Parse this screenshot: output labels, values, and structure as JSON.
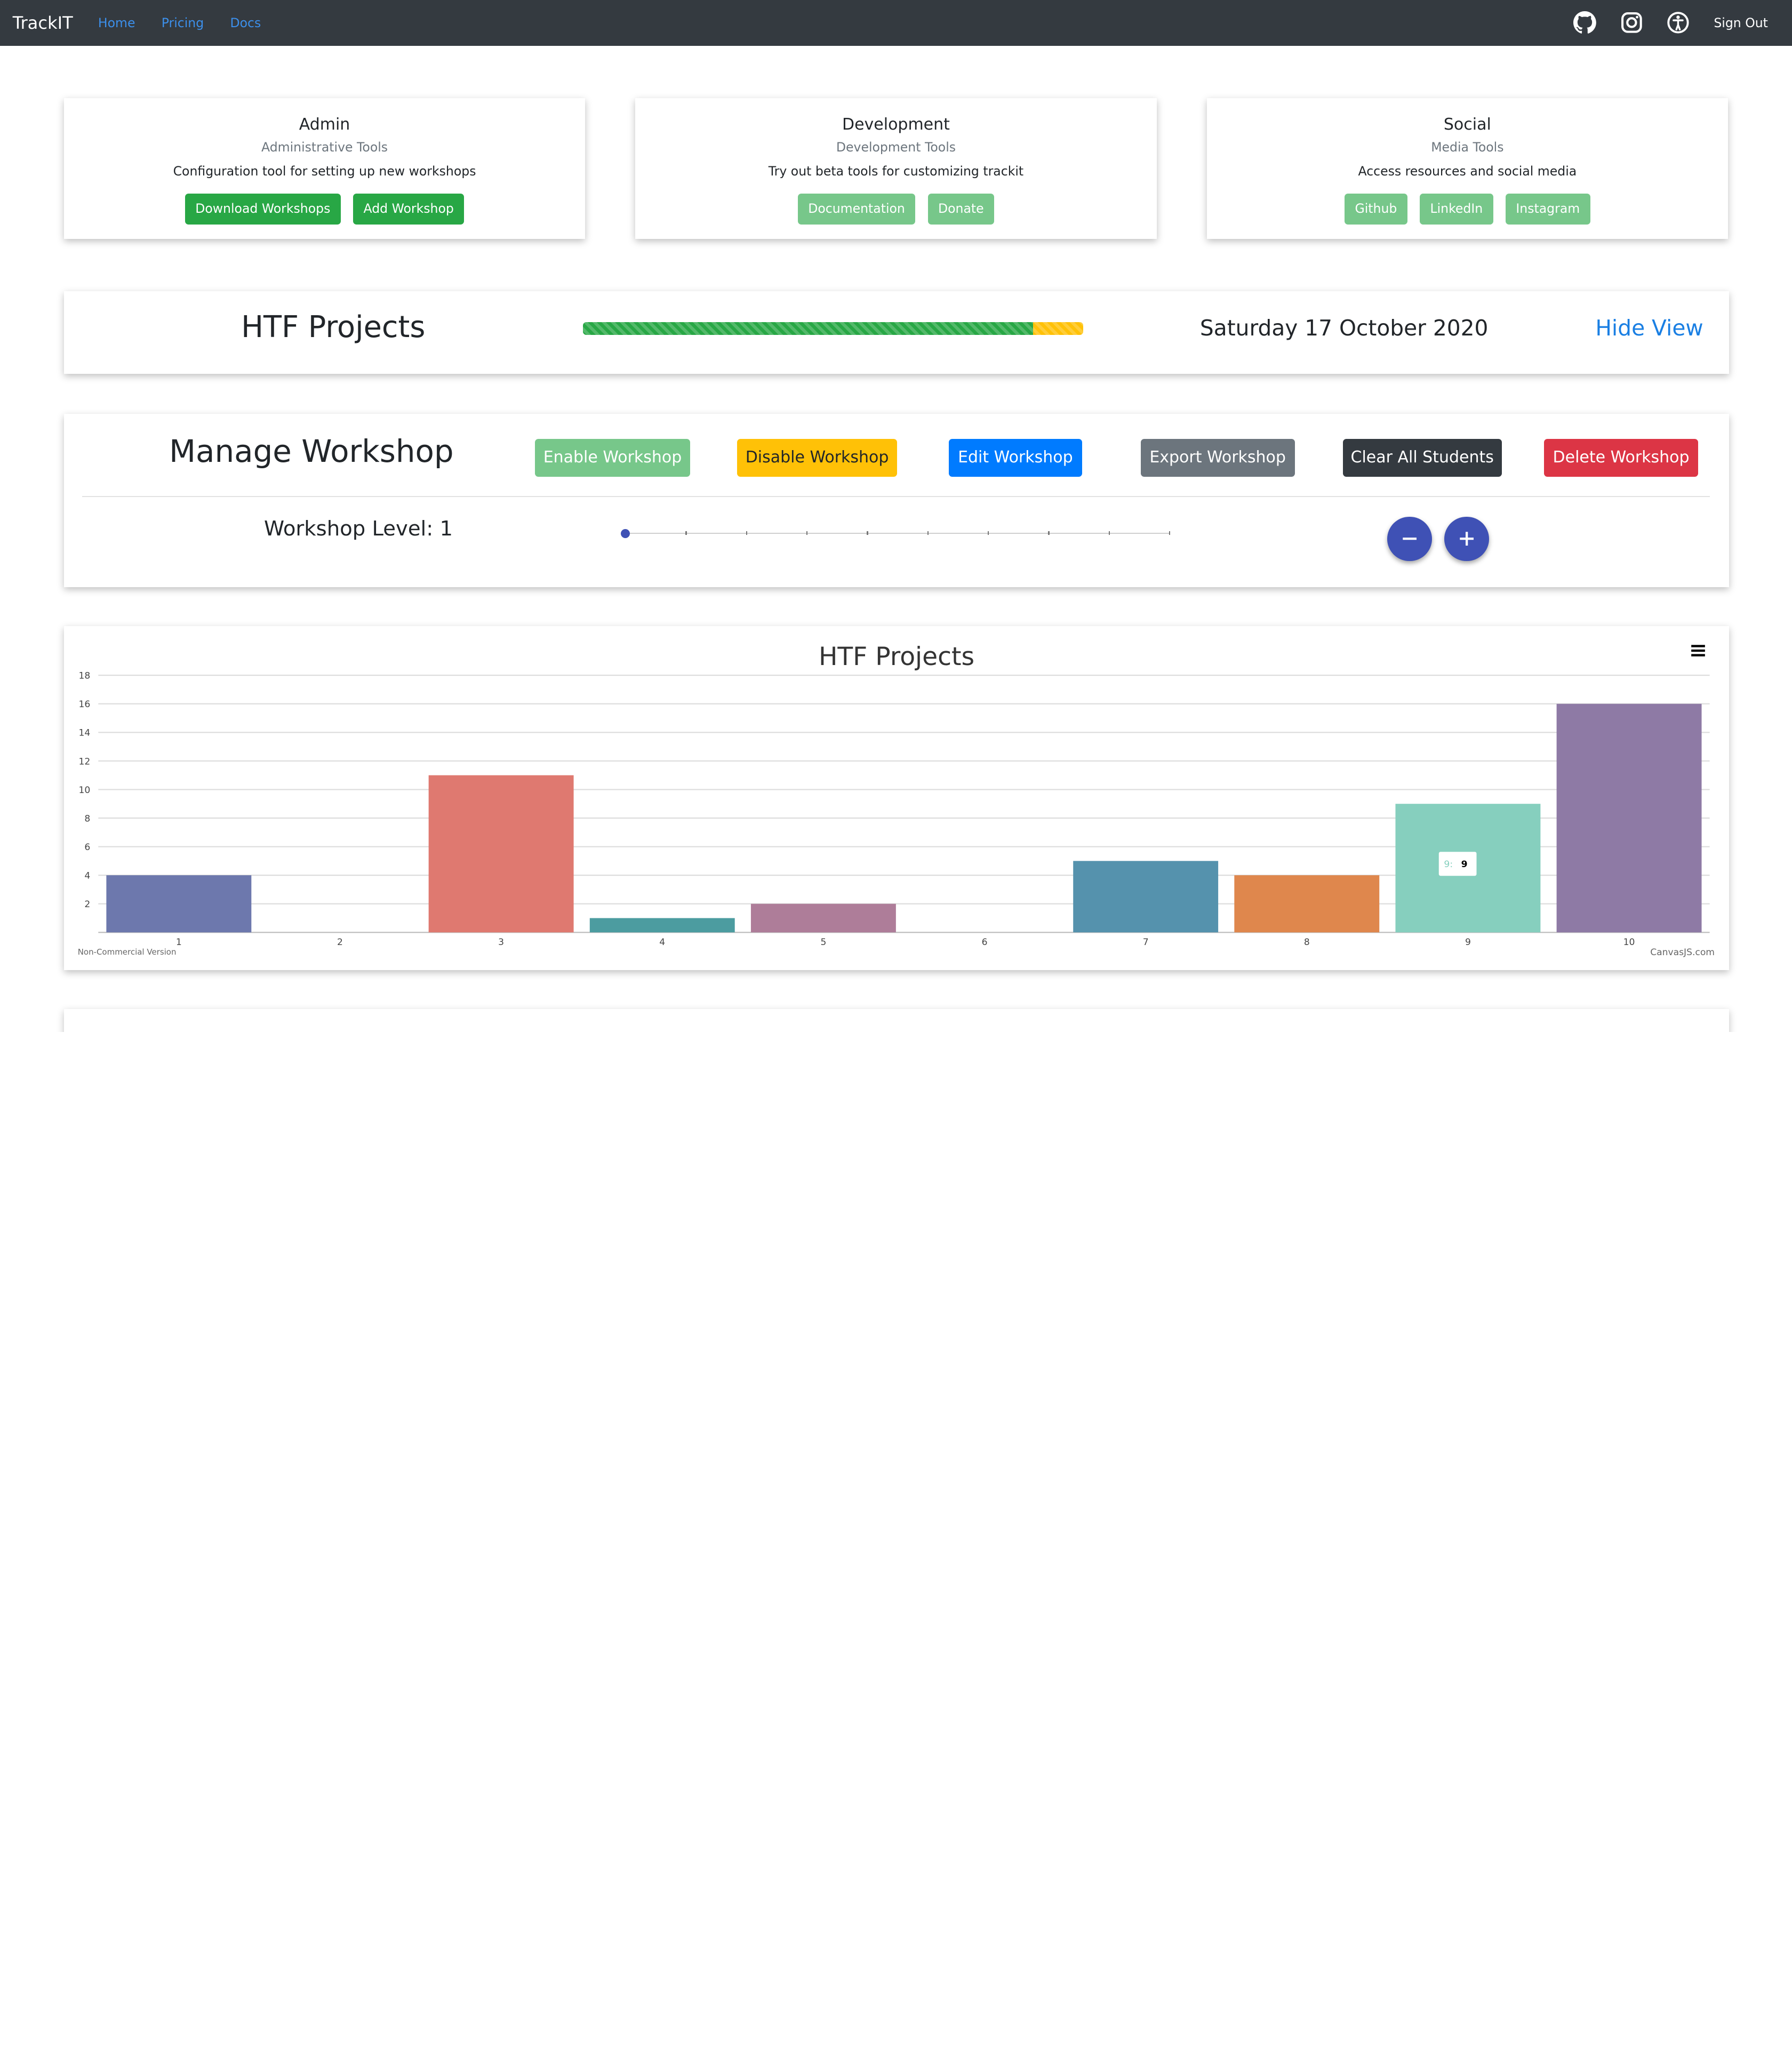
{
  "navbar": {
    "brand": "TrackIT",
    "links": [
      "Home",
      "Pricing",
      "Docs"
    ],
    "icons": [
      "github-icon",
      "instagram-icon",
      "accessibility-icon"
    ],
    "sign_out": "Sign Out"
  },
  "cards": [
    {
      "title": "Admin",
      "subtitle": "Administrative Tools",
      "desc": "Configuration tool for setting up new workshops",
      "buttons": [
        "Download Workshops",
        "Add Workshop"
      ]
    },
    {
      "title": "Development",
      "subtitle": "Development Tools",
      "desc": "Try out beta tools for customizing trackit",
      "buttons": [
        "Documentation",
        "Donate"
      ]
    },
    {
      "title": "Social",
      "subtitle": "Media Tools",
      "desc": "Access resources and social media",
      "buttons": [
        "Github",
        "LinkedIn",
        "Instagram"
      ]
    }
  ],
  "htf": {
    "title": "HTF Projects",
    "progress_percent": 90,
    "date": "Saturday 17 October 2020",
    "hide_view": "Hide View"
  },
  "manage": {
    "title": "Manage Workshop",
    "buttons": [
      "Enable Workshop",
      "Disable Workshop",
      "Edit Workshop",
      "Export Workshop",
      "Clear All Students",
      "Delete Workshop"
    ],
    "level_label": "Workshop Level: 1",
    "level_value": 1,
    "level_max": 10
  },
  "colors": {
    "navbar": "#343a40",
    "link": "#3c8fea",
    "success": "#28a745",
    "success_light": "#77c78a",
    "warning": "#ffc107",
    "primary": "#007bff",
    "secondary": "#6c757d",
    "dark": "#343a40",
    "danger": "#dc3545",
    "indigo": "#3f51b5"
  },
  "chart_data": {
    "type": "bar",
    "title": "HTF Projects",
    "categories": [
      "1",
      "2",
      "3",
      "4",
      "5",
      "6",
      "7",
      "8",
      "9",
      "10"
    ],
    "values": [
      4,
      0,
      11,
      1,
      2,
      0,
      5,
      4,
      9,
      16
    ],
    "colors": [
      "#6d78ad",
      "#51cda0",
      "#df7970",
      "#4c9ca0",
      "#ae7d99",
      "#c9d45c",
      "#5592ad",
      "#df874d",
      "#86cfbe",
      "#8e7aa5"
    ],
    "ylim": [
      0,
      18
    ],
    "yticks": [
      2,
      4,
      6,
      8,
      10,
      12,
      14,
      16,
      18
    ],
    "grid": true,
    "tooltip": {
      "label": "9:",
      "value": "9"
    },
    "credit_left": "Non-Commercial Version",
    "credit_right": "CanvasJS.com"
  }
}
